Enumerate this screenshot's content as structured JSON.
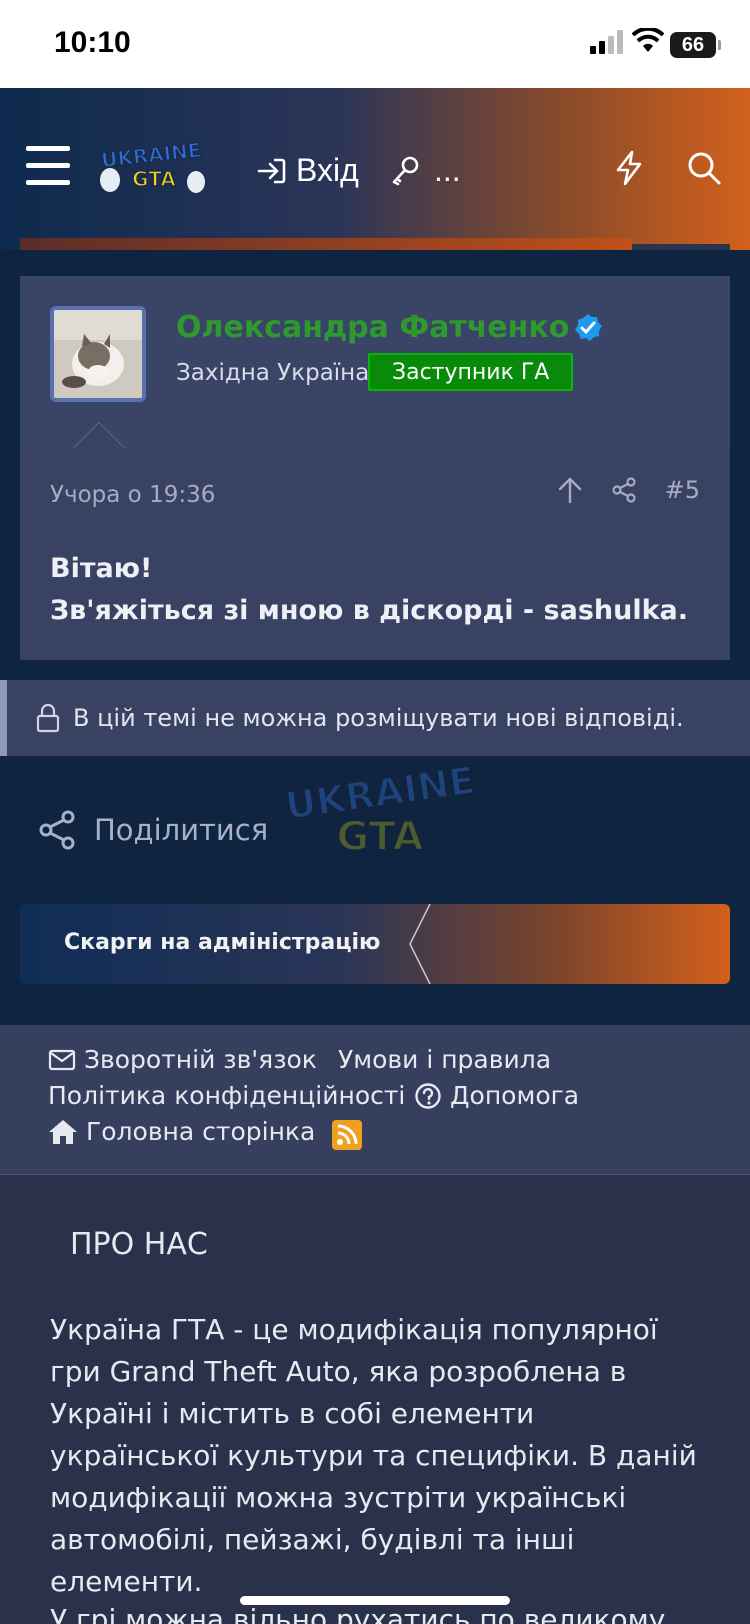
{
  "status_bar": {
    "time": "10:10",
    "battery": "66"
  },
  "header": {
    "login_label": "Вхід",
    "register_label": "...",
    "logo_alt": "Ukraine GTA"
  },
  "post": {
    "username": "Олександра Фатченко",
    "user_location": "Західна Україна",
    "role": "Заступник ГА",
    "date": "Учора о 19:36",
    "post_number": "#5",
    "text_line1": "Вітаю!",
    "text_line2": "Зв'яжіться зі мною в діскорді - sashulka."
  },
  "notice": "В цій темі не можна розміщувати нові відповіді.",
  "share_label": "Поділитися",
  "breadcrumb": "Скарги на адміністрацію",
  "footer": {
    "contact": "Зворотній зв'язок",
    "terms": "Умови і правила",
    "privacy": "Політика конфіденційності",
    "help": "Допомога",
    "home": "Головна сторінка"
  },
  "about": {
    "title": "ПРО НАС",
    "text": "Україна ГТА - це модифікація популярної гри Grand Theft Auto, яка розроблена в Україні і містить в собі елементи української культури та специфіки. В даній модифікації можна зустріти українські автомобілі, пейзажі, будівлі та інші елементи.",
    "text2": "У грі можна вільно рухатись по великому"
  },
  "colors": {
    "username": "#2e9a2e",
    "role_badge": "#0a8a0a",
    "verified": "#1d9bf0",
    "rss": "#f0a020"
  }
}
